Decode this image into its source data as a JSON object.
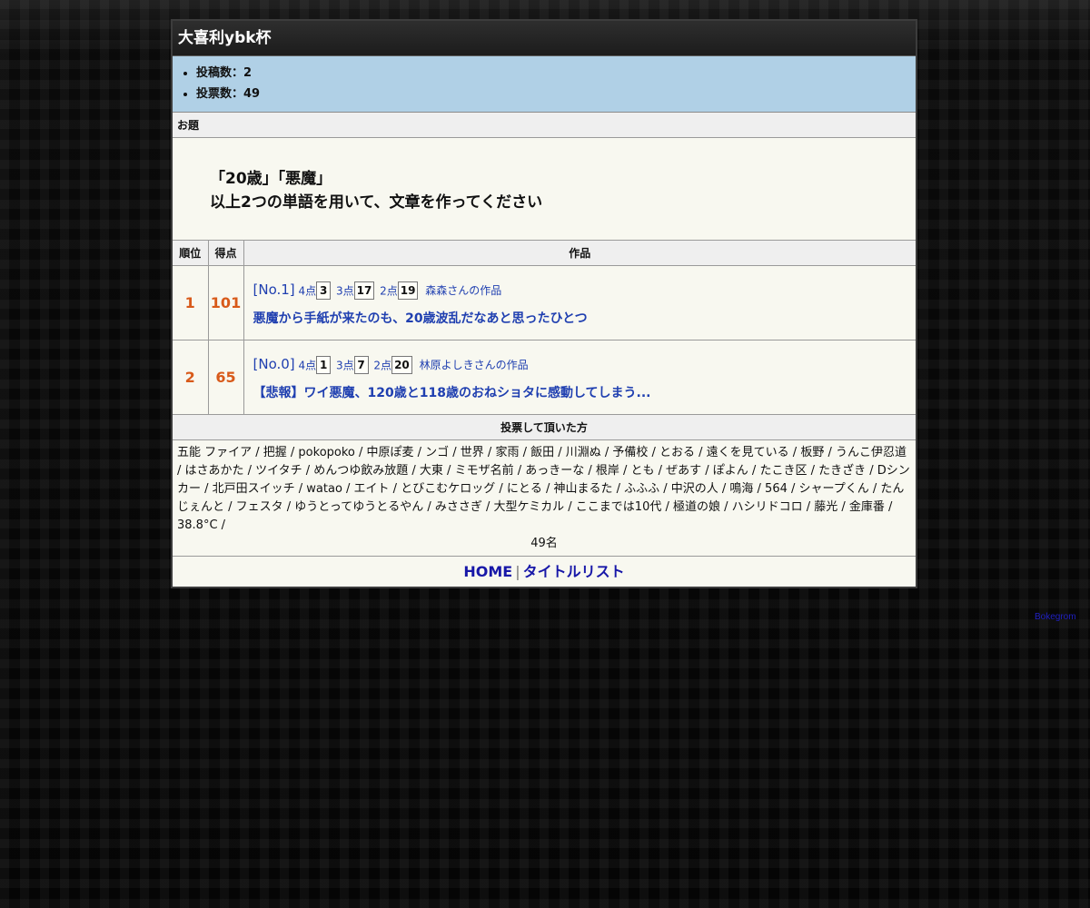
{
  "page_title": "大喜利ybk杯",
  "stats": [
    "投稿数：2",
    "投票数：49"
  ],
  "odai": {
    "header": "お題",
    "line1": "「20歳」「悪魔」",
    "line2": "以上2つの単語を用いて、文章を作ってください"
  },
  "table": {
    "headers": {
      "rank": "順位",
      "score": "得点",
      "work": "作品"
    },
    "rows": [
      {
        "rank": "1",
        "score": "101",
        "number": "[No.1]",
        "points": [
          {
            "label": "4点",
            "count": "3"
          },
          {
            "label": "3点",
            "count": "17"
          },
          {
            "label": "2点",
            "count": "19"
          }
        ],
        "author": "森森さんの作品",
        "text": "悪魔から手紙が来たのも、20歳波乱だなあと思ったひとつ"
      },
      {
        "rank": "2",
        "score": "65",
        "number": "[No.0]",
        "points": [
          {
            "label": "4点",
            "count": "1"
          },
          {
            "label": "3点",
            "count": "7"
          },
          {
            "label": "2点",
            "count": "20"
          }
        ],
        "author": "林原よしきさんの作品",
        "text": "【悲報】ワイ悪魔、120歳と118歳のおねショタに感動してしまう..."
      }
    ]
  },
  "voters": {
    "header": "投票して頂いた方",
    "list": "五能 ファイア / 把握 / pokopoko / 中原ぽ麦 / ンゴ / 世界 / 家雨 / 飯田 / 川淵ぬ / 予備校 / とおる / 遠くを見ている / 板野 / うんこ伊忍道 / はさあかた / ツイタチ / めんつゆ飲み放題 / 大東 / ミモザ名前 / あっきーな / 根岸 / とも / ぜあす / ぽよん / たこき区 / たきざき / Dシンカー / 北戸田スイッチ / watao / エイト / とびこむケロッグ / にとる / 神山まるた / ふふふ / 中沢の人 / 鳴海 / 564 / シャープくん / たんじぇんと / フェスタ / ゆうとってゆうとるやん / みささぎ / 大型ケミカル / ここまでは10代 / 極道の娘 / ハシリドコロ / 藤光 / 金庫番 / 38.8°C /",
    "count": "49名"
  },
  "footer": {
    "home": "HOME",
    "separator": "|",
    "title_list": "タイトルリスト"
  },
  "credit": "Bokegrom"
}
